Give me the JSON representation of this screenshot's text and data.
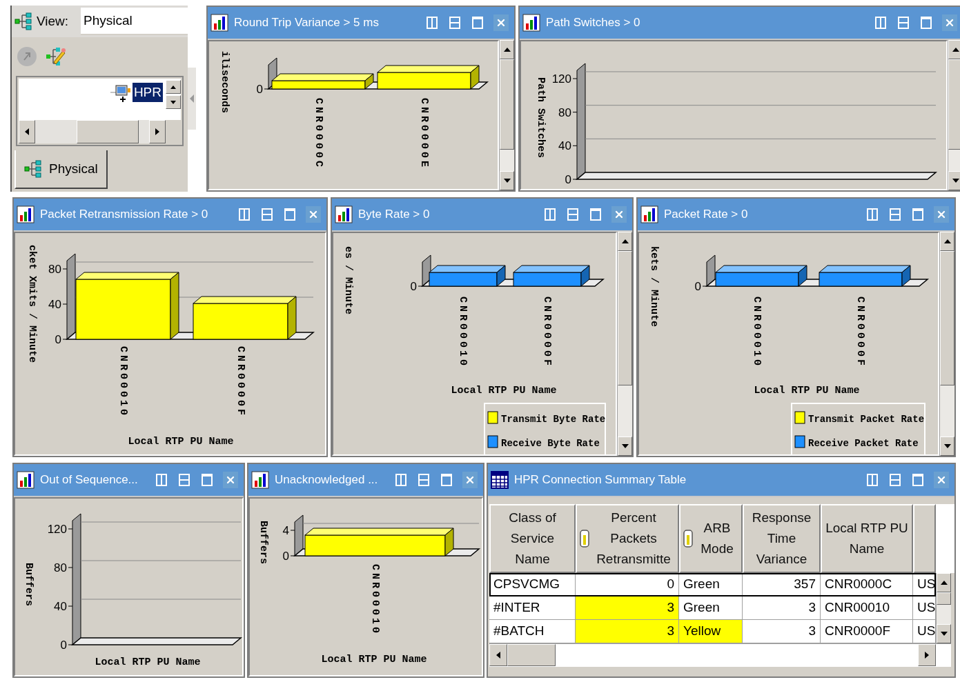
{
  "navigator": {
    "view_label": "View:",
    "view_value": "Physical",
    "tools": [
      {
        "kind": "back",
        "disabled": true
      },
      {
        "kind": "edit",
        "disabled": false
      }
    ],
    "tree": [
      {
        "label": "HPR",
        "selected": true
      }
    ],
    "tabs": [
      {
        "label": "Physical",
        "selected": true
      }
    ]
  },
  "rows": [
    {
      "panels": [
        {
          "kind": "chart",
          "title": "Round Trip Variance > 5 ms",
          "chart": {
            "ylabel": "iliseconds",
            "yticks": [
              "0"
            ],
            "categories": [
              "CNR0000C",
              "CNR0000E"
            ]
          }
        },
        {
          "kind": "chart",
          "title": "Path Switches > 0",
          "chart": {
            "ylabel": "Path Switches",
            "yticks": [
              "120",
              "80",
              "40",
              "0"
            ]
          }
        }
      ]
    },
    {
      "panels": [
        {
          "kind": "chart",
          "title": "Packet Retransmission Rate > 0",
          "chart": {
            "ylabel": "cket Xmits / Minute",
            "yticks": [
              "80",
              "40",
              "0"
            ],
            "categories": [
              "CNR00010",
              "CNR0000F"
            ],
            "xlabel": "Local RTP PU Name"
          }
        },
        {
          "kind": "chart",
          "title": "Byte Rate > 0",
          "chart": {
            "ylabel": "es / Minute",
            "yticks": [
              "0"
            ],
            "categories": [
              "CNR00010",
              "CNR0000F"
            ],
            "xlabel": "Local RTP PU Name",
            "legend": [
              {
                "label": "Transmit Byte Rate",
                "color": "#ffff00"
              },
              {
                "label": "Receive Byte Rate",
                "color": "#1e90ff"
              }
            ]
          }
        },
        {
          "kind": "chart",
          "title": "Packet Rate > 0",
          "chart": {
            "ylabel": "kets / Minute",
            "yticks": [
              "0"
            ],
            "categories": [
              "CNR00010",
              "CNR0000F"
            ],
            "xlabel": "Local RTP PU Name",
            "legend": [
              {
                "label": "Transmit Packet Rate",
                "color": "#ffff00"
              },
              {
                "label": "Receive Packet Rate",
                "color": "#1e90ff"
              }
            ]
          }
        }
      ]
    },
    {
      "panels": [
        {
          "kind": "chart",
          "title": "Out of Sequence...",
          "chart": {
            "ylabel": "Buffers",
            "yticks": [
              "120",
              "80",
              "40",
              "0"
            ],
            "xlabel": "Local RTP PU Name"
          }
        },
        {
          "kind": "chart",
          "title": "Unacknowledged ...",
          "chart": {
            "ylabel": "Buffers",
            "yticks": [
              "4",
              "0"
            ],
            "categories": [
              "CNR00010"
            ],
            "xlabel": "Local RTP PU Name"
          }
        },
        {
          "kind": "table",
          "title": "HPR Connection Summary Table",
          "columns": [
            {
              "label": "Class of Service Name",
              "kind": "text",
              "icon": false
            },
            {
              "label": "Percent Packets Retransmitte",
              "kind": "number",
              "icon": true
            },
            {
              "label": "ARB Mode",
              "kind": "text",
              "icon": true
            },
            {
              "label": "Response Time Variance",
              "kind": "number",
              "icon": false
            },
            {
              "label": "Local RTP PU Name",
              "kind": "text",
              "icon": false
            },
            {
              "kind": "text",
              "icon": false
            }
          ],
          "rows": [
            {
              "selected": true,
              "cells": [
                {
                  "text": "CPSVCMG",
                  "highlighted": false
                },
                {
                  "text": "0",
                  "highlighted": false
                },
                {
                  "text": "Green",
                  "highlighted": false
                },
                {
                  "text": "357",
                  "highlighted": false
                },
                {
                  "text": "CNR0000C",
                  "highlighted": false
                },
                {
                  "text": "US",
                  "highlighted": false
                }
              ]
            },
            {
              "selected": false,
              "cells": [
                {
                  "text": "#INTER",
                  "highlighted": false
                },
                {
                  "text": "3",
                  "highlighted": true
                },
                {
                  "text": "Green",
                  "highlighted": false
                },
                {
                  "text": "3",
                  "highlighted": false
                },
                {
                  "text": "CNR00010",
                  "highlighted": false
                },
                {
                  "text": "US",
                  "highlighted": false
                }
              ]
            },
            {
              "selected": false,
              "cells": [
                {
                  "text": "#BATCH",
                  "highlighted": false
                },
                {
                  "text": "3",
                  "highlighted": true
                },
                {
                  "text": "Yellow",
                  "highlighted": true
                },
                {
                  "text": "3",
                  "highlighted": false
                },
                {
                  "text": "CNR0000F",
                  "highlighted": false
                },
                {
                  "text": "US",
                  "highlighted": false
                }
              ]
            }
          ]
        }
      ]
    }
  ]
}
